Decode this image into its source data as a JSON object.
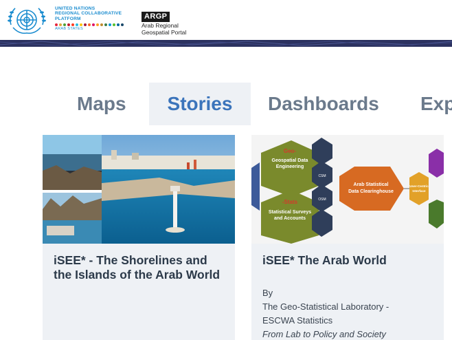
{
  "header": {
    "un_lines": [
      "UNITED NATIONS",
      "REGIONAL COLLABORATIVE",
      "PLATFORM"
    ],
    "un_sub": "ARAB STATES",
    "argp_badge": "ARGP",
    "argp_line1": "Arab Regional",
    "argp_line2": "Geospatial Portal"
  },
  "tabs": [
    {
      "label": "Maps"
    },
    {
      "label": "Stories",
      "active": true
    },
    {
      "label": "Dashboards"
    },
    {
      "label": "Exp"
    }
  ],
  "cards": [
    {
      "title": "iSEE* - The Shorelines and the Islands of the Arab World"
    },
    {
      "title": "iSEE* The Arab World",
      "by": "By",
      "author_line1": "The Geo-Statistical Laboratory -",
      "author_line2": "ESCWA Statistics",
      "source": "From Lab to Policy and Society"
    }
  ],
  "diagram": {
    "geo_title": "Geo-",
    "geo_sub": "Geospatial Data",
    "geo_sub2": "Engineering",
    "stats_title": "-Stats",
    "stats_sub": "Statistical Surveys",
    "stats_sub2": "and Accounts",
    "clearing_title": "Arab Statistical",
    "clearing_sub": "Data Clearinghouse",
    "user_centric": "User-Centric",
    "interface": "Interface",
    "osm": "OSM",
    "csm": "CSM"
  },
  "colors": {
    "brand_blue": "#1a8ccf",
    "tab_active": "#3b74bb",
    "tab_inactive": "#6b7a8c",
    "header_band": "#2c3260",
    "card_bg": "#eef1f5"
  }
}
